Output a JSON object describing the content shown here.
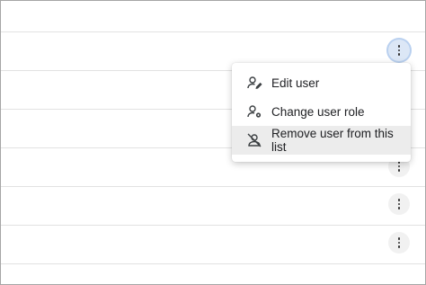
{
  "menu": {
    "items": [
      {
        "label": "Edit user",
        "icon": "edit-user-icon"
      },
      {
        "label": "Change user role",
        "icon": "user-settings-icon"
      },
      {
        "label": "Remove user from this list",
        "icon": "remove-user-icon"
      }
    ]
  },
  "colors": {
    "active_kebab_bg": "#dce7f6",
    "highlight_item_bg": "#ececec",
    "row_divider": "#e2e2e2"
  }
}
